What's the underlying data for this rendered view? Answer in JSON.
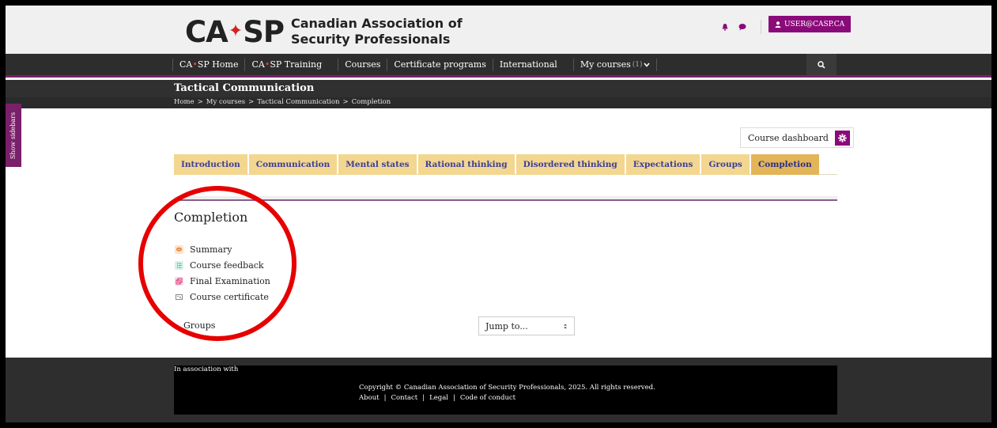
{
  "header": {
    "logo_mark_left": "CA",
    "logo_mark_right": "SP",
    "logo_line1": "Canadian Association of",
    "logo_line2": "Security Professionals",
    "user_label": "USER@CASP.CA"
  },
  "nav": {
    "home_prefix": "CA",
    "home_suffix": "SP Home",
    "training_prefix": "CA",
    "training_suffix": "SP Training",
    "courses": "Courses",
    "certificate_programs": "Certificate programs",
    "international": "International",
    "my_courses": "My courses",
    "my_courses_count": "(1)"
  },
  "course": {
    "title": "Tactical Communication"
  },
  "breadcrumb": {
    "home": "Home",
    "my_courses": "My courses",
    "course": "Tactical Communication",
    "current": "Completion",
    "separator": ">"
  },
  "sidebar_toggle": "Show sidebars",
  "dashboard_button": "Course dashboard",
  "tabs": [
    "Introduction",
    "Communication",
    "Mental states",
    "Rational thinking",
    "Disordered thinking",
    "Expectations",
    "Groups",
    "Completion"
  ],
  "section": {
    "title": "Completion",
    "activities": [
      {
        "label": "Summary",
        "icon": "chat-icon",
        "color": "#f08a3c"
      },
      {
        "label": "Course feedback",
        "icon": "feedback-list-icon",
        "color": "#2aa88a"
      },
      {
        "label": "Final Examination",
        "icon": "quiz-icon",
        "color": "#d8377a"
      },
      {
        "label": "Course certificate",
        "icon": "certificate-icon",
        "color": "#888888"
      }
    ]
  },
  "groups_link": "Groups",
  "jump_select": {
    "selected": "Jump to..."
  },
  "footer": {
    "association": "In association with",
    "copyright": "Copyright © Canadian Association of Security Professionals, 2025. All rights reserved.",
    "links": [
      "About",
      "Contact",
      "Legal",
      "Code of conduct"
    ],
    "link_separator": "|"
  },
  "colors": {
    "brand_purple": "#8a0a7a",
    "tab_bg": "#f3d68f",
    "tab_active_bg": "#e3b558",
    "tab_text": "#3a3f9c",
    "annotation_red": "#e60000"
  }
}
